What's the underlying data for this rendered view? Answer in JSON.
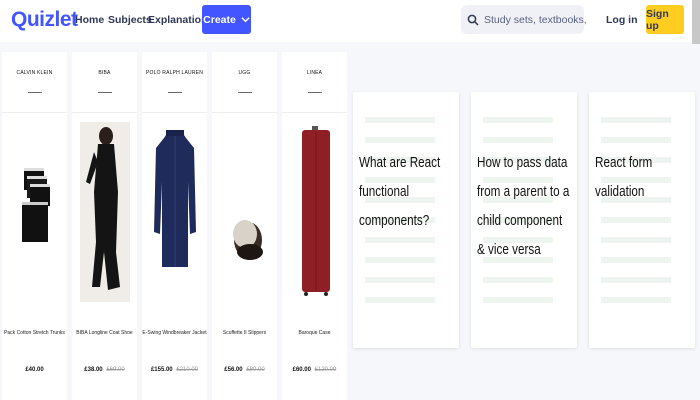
{
  "header": {
    "logo": "Quizlet",
    "nav": [
      "Home",
      "Subjects",
      "Explanations"
    ],
    "create_label": "Create",
    "search_placeholder": "Study sets, textbooks, ...",
    "login_label": "Log in",
    "signup_label": "Sign up"
  },
  "colors": {
    "brand": "#4255ff",
    "signup_bg": "#ffcd1f",
    "page_bg": "#f6f7fb"
  },
  "ads": [
    {
      "brand": "CALVIN KLEIN",
      "name": "Pack Cotton Stretch Trunks",
      "price": "£40.00",
      "old_price": "",
      "image": "underwear-stack"
    },
    {
      "brand": "BIBA",
      "name": "BIBA Longline Coat Shoe",
      "price": "£38.00",
      "old_price": "£69.00",
      "image": "black-coat"
    },
    {
      "brand": "POLO RALPH LAUREN",
      "name": "E-Swing Windbreaker Jacket",
      "price": "£155.00",
      "old_price": "£210.00",
      "image": "navy-jacket"
    },
    {
      "brand": "UGG",
      "name": "Scuffette II Slippers",
      "price": "£56.00",
      "old_price": "£80.00",
      "image": "slipper"
    },
    {
      "brand": "LINEA",
      "name": "Baroque Case",
      "price": "£60.00",
      "old_price": "£120.00",
      "image": "red-suitcase"
    }
  ],
  "cards": [
    {
      "title": "What are React functional components?"
    },
    {
      "title": "How to pass data from a parent to a child component & vice versa"
    },
    {
      "title": "React form validation"
    }
  ]
}
